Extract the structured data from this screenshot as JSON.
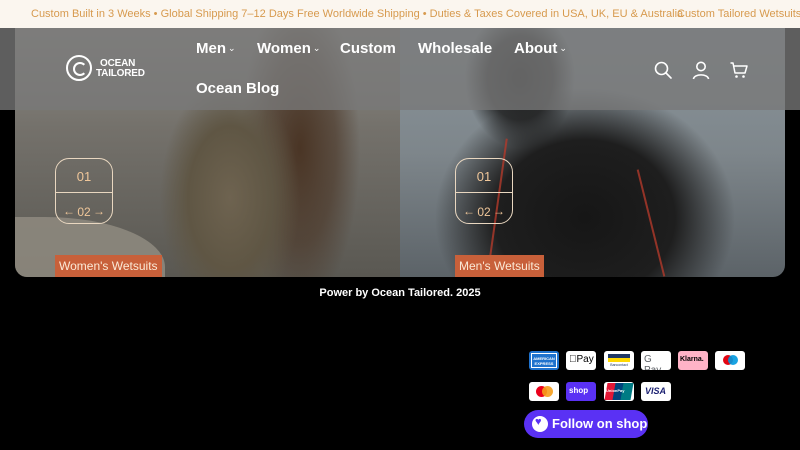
{
  "announcement": {
    "items": [
      "Custom Built in 3 Weeks • Global Shipping 7–12 Days",
      "Free Worldwide Shipping • Duties & Taxes Covered in USA, UK, EU & Australia",
      "Custom Tailored Wetsuits L"
    ]
  },
  "header": {
    "logo_text_line1": "OCEAN",
    "logo_text_line2": "TAILORED",
    "nav": {
      "men": "Men",
      "women": "Women",
      "custom": "Custom",
      "wholesale": "Wholesale",
      "about": "About",
      "blog": "Ocean Blog"
    },
    "icons": [
      "search-icon",
      "account-icon",
      "cart-icon"
    ]
  },
  "hero": {
    "left": {
      "counter_current": "01",
      "counter_next": "02",
      "label": "Women's Wetsuits"
    },
    "right": {
      "counter_current": "01",
      "counter_next": "02",
      "label": "Men's Wetsuits"
    }
  },
  "footer": {
    "power_text": "Power by Ocean Tailored. 2025",
    "payments": {
      "amex": "AMERICAN EXPRESS",
      "applepay": "Pay",
      "bancontact": "Bancontact",
      "gpay": "G Pay",
      "klarna": "Klarna.",
      "maestro": "maestro",
      "mastercard": "mastercard",
      "shoppay": "shop",
      "unionpay": "UnionPay",
      "visa": "VISA"
    },
    "follow_label": "Follow on shop"
  },
  "colors": {
    "accent": "#c8603a",
    "announce_text": "#d79a4e",
    "shop_purple": "#5a31f4"
  }
}
